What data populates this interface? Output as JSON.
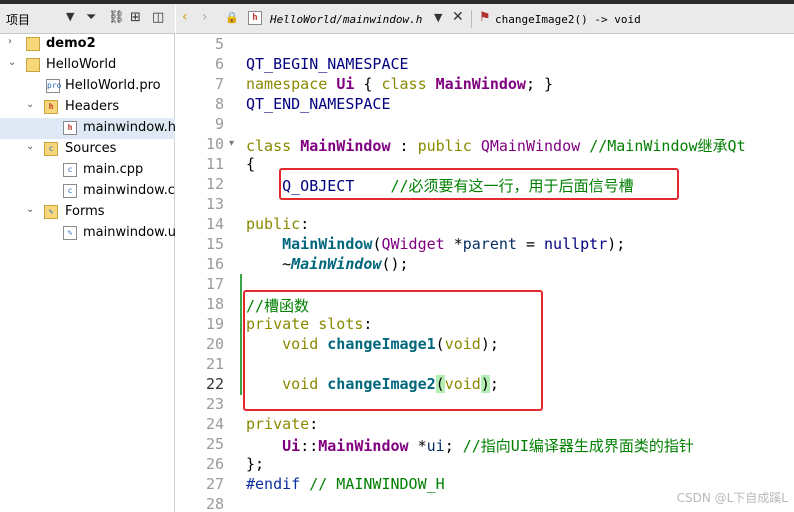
{
  "left_panel": {
    "title": "项目",
    "tree": [
      {
        "label": "demo2",
        "bold": true,
        "expanded": false,
        "icon": "project-icon"
      },
      {
        "label": "HelloWorld",
        "bold": false,
        "expanded": true,
        "icon": "project-icon"
      },
      {
        "label": "HelloWorld.pro",
        "icon": "pro-file-icon"
      },
      {
        "label": "Headers",
        "expanded": true,
        "icon": "header-folder-icon"
      },
      {
        "label": "mainwindow.h",
        "icon": "header-file-icon"
      },
      {
        "label": "Sources",
        "expanded": true,
        "icon": "source-folder-icon"
      },
      {
        "label": "main.cpp",
        "icon": "cpp-file-icon"
      },
      {
        "label": "mainwindow.cpp",
        "icon": "cpp-file-icon"
      },
      {
        "label": "Forms",
        "expanded": true,
        "icon": "forms-folder-icon"
      },
      {
        "label": "mainwindow.ui",
        "icon": "ui-file-icon"
      }
    ]
  },
  "editor_tabs": {
    "file_name": "HelloWorld/mainwindow.h",
    "symbol": "changeImage2() -> void"
  },
  "editor": {
    "current_line": 22,
    "lines": [
      {
        "no": "5",
        "text": ""
      },
      {
        "no": "6",
        "text": "QT_BEGIN_NAMESPACE"
      },
      {
        "no": "7",
        "text": "namespace Ui { class MainWindow; }"
      },
      {
        "no": "8",
        "text": "QT_END_NAMESPACE"
      },
      {
        "no": "9",
        "text": ""
      },
      {
        "no": "10",
        "text": "class MainWindow : public QMainWindow //MainWindow继承Qt"
      },
      {
        "no": "11",
        "text": "{"
      },
      {
        "no": "12",
        "text": "    Q_OBJECT    //必须要有这一行，用于后面信号槽"
      },
      {
        "no": "13",
        "text": ""
      },
      {
        "no": "14",
        "text": "public:"
      },
      {
        "no": "15",
        "text": "    MainWindow(QWidget *parent = nullptr);"
      },
      {
        "no": "16",
        "text": "    ~MainWindow();"
      },
      {
        "no": "17",
        "text": ""
      },
      {
        "no": "18",
        "text": "//槽函数"
      },
      {
        "no": "19",
        "text": "private slots:"
      },
      {
        "no": "20",
        "text": "    void changeImage1(void);"
      },
      {
        "no": "21",
        "text": ""
      },
      {
        "no": "22",
        "text": "    void changeImage2(void);"
      },
      {
        "no": "23",
        "text": ""
      },
      {
        "no": "24",
        "text": "private:"
      },
      {
        "no": "25",
        "text": "    Ui::MainWindow *ui; //指向UI编译器生成界面类的指针"
      },
      {
        "no": "26",
        "text": "};"
      },
      {
        "no": "27",
        "text": "#endif // MAINWINDOW_H"
      },
      {
        "no": "28",
        "text": ""
      }
    ]
  },
  "watermark": "CSDN @L下自成蹊L",
  "colors": {
    "highlight_box": "#e3292e",
    "changed_marker": "#3aa64a",
    "selection": "#dfe9f5"
  }
}
